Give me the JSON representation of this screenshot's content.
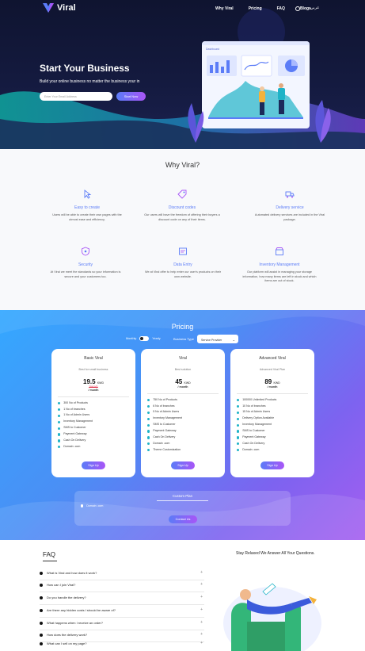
{
  "nav": {
    "brand": "Viral",
    "links": [
      "Why Viral",
      "Pricing",
      "FAQ",
      "Blogs"
    ],
    "lang": "عربي"
  },
  "hero": {
    "title": "Start Your Business",
    "subtitle": "Build your online business no matter the business your in",
    "input_placeholder": "Enter Your Email Address",
    "cta": "Start Now",
    "dashboard_label": "Dashboard"
  },
  "why": {
    "title": "Why Viral?",
    "features": [
      {
        "icon": "pointer-icon",
        "title": "Easy to create",
        "desc": "Users will be able to create their own pages with the utmost ease and efficiency."
      },
      {
        "icon": "discount-tag-icon",
        "title": "Discount codes",
        "desc": "Our users will have the freedom of offering their buyers a discount code on any of their items."
      },
      {
        "icon": "delivery-truck-icon",
        "title": "Delivery service",
        "desc": "Automated delivery services are included in the Viral package."
      },
      {
        "icon": "shield-icon",
        "title": "Security",
        "desc": "At Viral we meet the standards so your information is secure and your customers too."
      },
      {
        "icon": "data-entry-icon",
        "title": "Data Entry",
        "desc": "We at Viral offer to help enter our user's products on their own website."
      },
      {
        "icon": "inventory-icon",
        "title": "Inventory Management",
        "desc": "Our platform will assist in managing your storage information, how many items are left in stock and which items are out of stock."
      }
    ]
  },
  "pricing": {
    "title": "Pricing",
    "toggle_monthly": "Monthly",
    "toggle_yearly": "Yearly",
    "business_type_label": "Business Type",
    "business_type_value": "Service Provider",
    "plans": [
      {
        "name": "Basic Viral",
        "sub": "Best for small business",
        "price": "19.5",
        "currency": "KWD",
        "strike": "29KWD",
        "period": "/ month",
        "features": [
          "300 No of Products",
          "1 No of branches",
          "1 No of Admin Users",
          "Inventory Management",
          "SMS to Customer",
          "Payment Gateway",
          "Cash On Delivery",
          "Domain .com"
        ],
        "button": "Sign Up"
      },
      {
        "name": "Viral",
        "sub": "Best solution",
        "price": "45",
        "currency": "KWD",
        "strike": "",
        "period": "/ month",
        "features": [
          "750 No of Products",
          "6 No of branches",
          "5 No of Admin Users",
          "Inventory Management",
          "SMS to Customer",
          "Payment Gateway",
          "Cash On Delivery",
          "Domain .com",
          "Theme Customization"
        ],
        "button": "Sign Up"
      },
      {
        "name": "Advanced Viral",
        "sub": "Advanced Viral Plan",
        "price": "89",
        "currency": "KWD",
        "strike": "",
        "period": "/ month",
        "features": [
          "100000 Unlimited Products",
          "10 No of branches",
          "15 No of Admin Users",
          "Delivery Option Available",
          "Inventory Management",
          "SMS to Customer",
          "Payment Gateway",
          "Cash On Delivery",
          "Domain .com"
        ],
        "button": "Sign Up"
      }
    ],
    "custom": {
      "title": "Custom Plan",
      "item": "Domain .com",
      "button": "Contact Us"
    }
  },
  "faq": {
    "title": "FAQ",
    "side_title": "Stay Relaxed We Answer All Your Questions.",
    "questions": [
      "What is Viral and how does it work?",
      "How can I join Viral?",
      "Do you handle the delivery?",
      "Are there any hidden costs I should be aware of?",
      "What happens when I receive an order?",
      "How does the delivery work?",
      "What can I sell on my page?"
    ]
  },
  "colors": {
    "accent": "#5b7cf7",
    "accent2": "#a855f7",
    "hero_bg": "#141a3f",
    "teal": "#1fb3c7"
  }
}
